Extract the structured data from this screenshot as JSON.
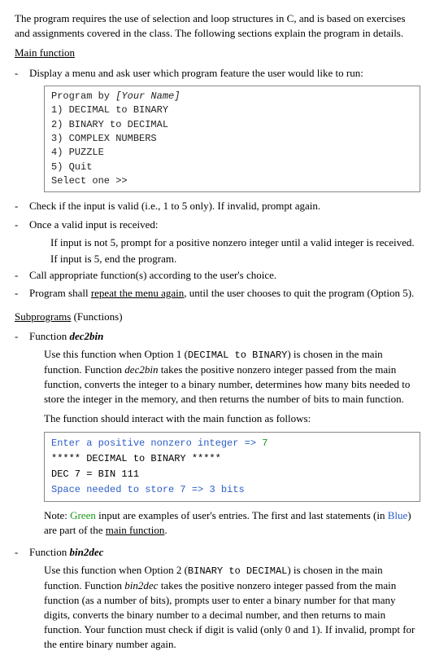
{
  "intro": "The program requires the use of selection and loop structures in C, and is based on exercises and assignments covered in the class. The following sections explain the program in details.",
  "mainFunction": {
    "heading": "Main function",
    "bullet1": "Display a menu and ask user which program feature the user would like to run:",
    "menu": {
      "l1a": "Program by ",
      "l1b": "[Your Name]",
      "l2": "1) DECIMAL to BINARY",
      "l3": "2) BINARY to DECIMAL",
      "l4": "3) COMPLEX NUMBERS",
      "l5": "4) PUZZLE",
      "l6": "5) Quit",
      "l7": "Select one >>"
    },
    "bullet2": "Check if the input is valid (i.e., 1 to 5 only). If invalid, prompt again.",
    "bullet3": "Once a valid input is received:",
    "bullet3a": "If input is not 5, prompt for a positive nonzero integer until a valid integer is received.",
    "bullet3b": "If input is 5, end the program.",
    "bullet4": "Call appropriate function(s) according to the user's choice.",
    "bullet5a": "Program shall ",
    "bullet5b": "repeat the menu again",
    "bullet5c": ", until the user chooses to quit the program (Option 5)."
  },
  "subprograms": {
    "heading_a": "Subprograms",
    "heading_b": " (Functions)",
    "dec2bin": {
      "title_a": "Function ",
      "title_b": "dec2bin",
      "p1a": "Use this function when Option 1 (",
      "p1b": "DECIMAL to BINARY",
      "p1c": ") is chosen in the main function. Function ",
      "p1d": "dec2bin",
      "p1e": " takes the positive nonzero integer passed from the main function, converts the integer to a binary number, determines how many bits needed to store the integer in the memory, and then returns the number of bits to main function.",
      "p2": "The function should interact with the main function as follows:",
      "interact": {
        "l1a": "Enter a positive nonzero integer => ",
        "l1b": "7",
        "l2": "***** DECIMAL to BINARY *****",
        "l3": "DEC 7 = BIN 111",
        "l4a": "Space needed to store 7 => ",
        "l4b": "3 bits"
      },
      "note_a": "Note: ",
      "note_b": "Green",
      "note_c": " input are examples of user's entries. The first and last statements (in ",
      "note_d": "Blue",
      "note_e": ") are part of the ",
      "note_f": "main function",
      "note_g": "."
    },
    "bin2dec": {
      "title_a": "Function ",
      "title_b": "bin2dec",
      "p1a": "Use this function when Option 2 (",
      "p1b": "BINARY to DECIMAL",
      "p1c": ") is chosen in the main function. Function ",
      "p1d": "bin2dec",
      "p1e": " takes the positive nonzero integer passed from the main function (as a number of bits), prompts user to enter a binary number for that many digits, converts the binary number to a decimal number, and then returns to main function. Your function must check if digit is valid (only 0 and 1). If invalid, prompt for the entire binary number again."
    }
  }
}
